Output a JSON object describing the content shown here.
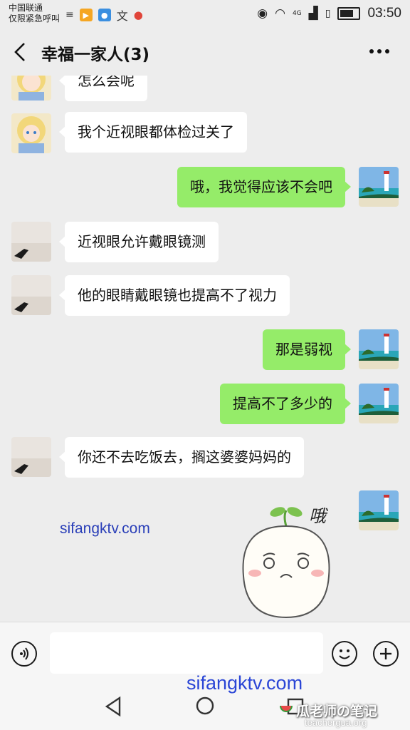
{
  "status_bar": {
    "carrier_line1": "中国联通",
    "carrier_line2": "仅限紧急呼叫",
    "time": "03:50",
    "network": "4G"
  },
  "header": {
    "title": "幸福一家人(3)"
  },
  "messages": [
    {
      "side": "in",
      "text": "怎么会呢"
    },
    {
      "side": "in",
      "text": "我个近视眼都体检过关了"
    },
    {
      "side": "out",
      "text": "哦，我觉得应该不会吧"
    },
    {
      "side": "in",
      "text": "近视眼允许戴眼镜测"
    },
    {
      "side": "in",
      "text": "他的眼睛戴眼镜也提高不了视力"
    },
    {
      "side": "out",
      "text": "那是弱视"
    },
    {
      "side": "out",
      "text": "提高不了多少的"
    },
    {
      "side": "in",
      "text": "你还不去吃饭去，搁这婆婆妈妈的"
    },
    {
      "side": "out",
      "sticker": true,
      "sticker_text": "哦"
    }
  ],
  "watermarks": {
    "chat_watermark": "sifangktv.com",
    "bottom_watermark": "sifangktv.com",
    "brand": "瓜老师の笔记",
    "brand_url": "teachergua.org"
  },
  "colors": {
    "out_bubble": "#95ec69",
    "in_bubble": "#ffffff",
    "background": "#ededed"
  }
}
